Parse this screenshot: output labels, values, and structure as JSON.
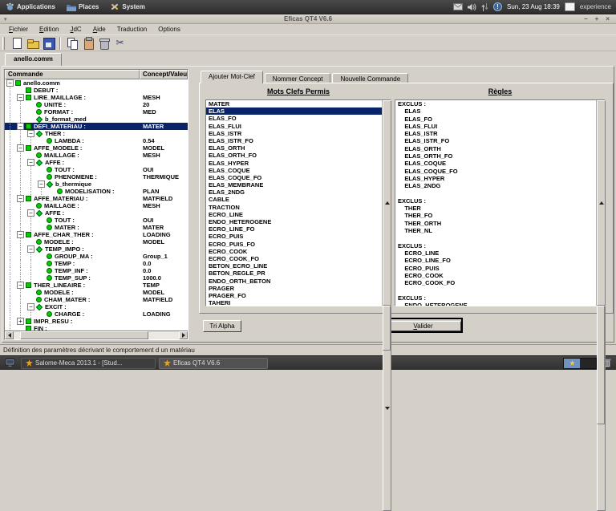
{
  "desktop": {
    "panel": {
      "menus": [
        {
          "label": "Applications",
          "icon": "applications-icon"
        },
        {
          "label": "Places",
          "icon": "places-icon"
        },
        {
          "label": "System",
          "icon": "system-icon"
        }
      ],
      "tray_icons": [
        "mail-icon",
        "volume-icon",
        "network-icon",
        "alert-icon",
        "display-icon"
      ],
      "alert_glyph": "!",
      "clock": "Sun, 23 Aug 18:39",
      "user": "experience"
    },
    "taskbar": {
      "windows": [
        {
          "label": "Salome-Meca 2013.1 - [Stud...",
          "active": false
        },
        {
          "label": "Eficas QT4 V6.6",
          "active": true
        }
      ],
      "workspace_count": 2,
      "active_workspace": 0
    }
  },
  "window": {
    "title": "Eficas QT4 V6.6",
    "controls": {
      "minimize": "–",
      "maximize": "+",
      "close": "×"
    },
    "menu_button_glyph": "▾",
    "menus": [
      {
        "label": "Fichier",
        "accel": 0
      },
      {
        "label": "Edition",
        "accel": 0
      },
      {
        "label": "JdC",
        "accel": 0
      },
      {
        "label": "Aide",
        "accel": 0
      },
      {
        "label": "Traduction",
        "accel": -1
      },
      {
        "label": "Options",
        "accel": -1
      }
    ],
    "toolbar": [
      "new-file",
      "open-file",
      "save",
      "copy",
      "paste",
      "delete",
      "cut"
    ],
    "document_tab": "anello.comm",
    "status_bar": "Définition des paramètres décrivant le comportement d un matériau"
  },
  "tree": {
    "columns": [
      "Commande",
      "Concept/Valeur"
    ],
    "rows": [
      {
        "label": "anello.comm",
        "value": "",
        "icon": "square",
        "level": 0,
        "exp": "minus"
      },
      {
        "label": "DEBUT :",
        "value": "",
        "icon": "square",
        "level": 1,
        "exp": ""
      },
      {
        "label": "LIRE_MAILLAGE :",
        "value": "MESH",
        "icon": "square",
        "level": 1,
        "exp": "minus"
      },
      {
        "label": "UNITE :",
        "value": "20",
        "icon": "circle",
        "level": 2,
        "exp": ""
      },
      {
        "label": "FORMAT :",
        "value": "MED",
        "icon": "circle",
        "level": 2,
        "exp": ""
      },
      {
        "label": "b_format_med",
        "value": "",
        "icon": "diamond",
        "level": 2,
        "exp": ""
      },
      {
        "label": "DEFI_MATERIAU :",
        "value": "MATER",
        "icon": "square",
        "level": 1,
        "exp": "minus",
        "selected": true
      },
      {
        "label": "THER :",
        "value": "",
        "icon": "diamond",
        "level": 2,
        "exp": "minus"
      },
      {
        "label": "LAMBDA :",
        "value": "0.54",
        "icon": "circle",
        "level": 3,
        "exp": ""
      },
      {
        "label": "AFFE_MODELE :",
        "value": "MODEL",
        "icon": "square",
        "level": 1,
        "exp": "minus"
      },
      {
        "label": "MAILLAGE :",
        "value": "MESH",
        "icon": "circle",
        "level": 2,
        "exp": ""
      },
      {
        "label": "AFFE :",
        "value": "",
        "icon": "diamond",
        "level": 2,
        "exp": "minus"
      },
      {
        "label": "TOUT :",
        "value": "OUI",
        "icon": "circle",
        "level": 3,
        "exp": ""
      },
      {
        "label": "PHENOMENE :",
        "value": "THERMIQUE",
        "icon": "circle",
        "level": 3,
        "exp": ""
      },
      {
        "label": "b_thermique",
        "value": "",
        "icon": "diamond",
        "level": 3,
        "exp": "minus"
      },
      {
        "label": "MODELISATION :",
        "value": "PLAN",
        "icon": "circle",
        "level": 4,
        "exp": ""
      },
      {
        "label": "AFFE_MATERIAU :",
        "value": "MATFIELD",
        "icon": "square",
        "level": 1,
        "exp": "minus"
      },
      {
        "label": "MAILLAGE :",
        "value": "MESH",
        "icon": "circle",
        "level": 2,
        "exp": ""
      },
      {
        "label": "AFFE :",
        "value": "",
        "icon": "diamond",
        "level": 2,
        "exp": "minus"
      },
      {
        "label": "TOUT :",
        "value": "OUI",
        "icon": "circle",
        "level": 3,
        "exp": ""
      },
      {
        "label": "MATER :",
        "value": "MATER",
        "icon": "circle",
        "level": 3,
        "exp": ""
      },
      {
        "label": "AFFE_CHAR_THER :",
        "value": "LOADING",
        "icon": "square",
        "level": 1,
        "exp": "minus"
      },
      {
        "label": "MODELE :",
        "value": "MODEL",
        "icon": "circle",
        "level": 2,
        "exp": ""
      },
      {
        "label": "TEMP_IMPO :",
        "value": "",
        "icon": "diamond",
        "level": 2,
        "exp": "minus"
      },
      {
        "label": "GROUP_MA :",
        "value": "Group_1",
        "icon": "circle",
        "level": 3,
        "exp": ""
      },
      {
        "label": "TEMP :",
        "value": "0.0",
        "icon": "circle",
        "level": 3,
        "exp": ""
      },
      {
        "label": "TEMP_INF :",
        "value": "0.0",
        "icon": "circle",
        "level": 3,
        "exp": ""
      },
      {
        "label": "TEMP_SUP :",
        "value": "1000.0",
        "icon": "circle",
        "level": 3,
        "exp": ""
      },
      {
        "label": "THER_LINEAIRE :",
        "value": "TEMP",
        "icon": "square",
        "level": 1,
        "exp": "minus"
      },
      {
        "label": "MODELE :",
        "value": "MODEL",
        "icon": "circle",
        "level": 2,
        "exp": ""
      },
      {
        "label": "CHAM_MATER :",
        "value": "MATFIELD",
        "icon": "circle",
        "level": 2,
        "exp": ""
      },
      {
        "label": "EXCIT :",
        "value": "",
        "icon": "diamond",
        "level": 2,
        "exp": "minus"
      },
      {
        "label": "CHARGE :",
        "value": "LOADING",
        "icon": "circle",
        "level": 3,
        "exp": ""
      },
      {
        "label": "IMPR_RESU :",
        "value": "",
        "icon": "square",
        "level": 1,
        "exp": "plus"
      },
      {
        "label": "FIN :",
        "value": "",
        "icon": "square",
        "level": 1,
        "exp": ""
      }
    ]
  },
  "right_panel": {
    "tabs": [
      "Ajouter Mot-Clef",
      "Nommer Concept",
      "Nouvelle Commande"
    ],
    "active_tab": "Ajouter Mot-Clef",
    "keywords": {
      "title": "Mots Clefs Permis",
      "selected": "ELAS",
      "items": [
        "MATER",
        "ELAS",
        "ELAS_FO",
        "ELAS_FLUI",
        "ELAS_ISTR",
        "ELAS_ISTR_FO",
        "ELAS_ORTH",
        "ELAS_ORTH_FO",
        "ELAS_HYPER",
        "ELAS_COQUE",
        "ELAS_COQUE_FO",
        "ELAS_MEMBRANE",
        "ELAS_2NDG",
        "CABLE",
        "TRACTION",
        "ECRO_LINE",
        "ENDO_HETEROGENE",
        "ECRO_LINE_FO",
        "ECRO_PUIS",
        "ECRO_PUIS_FO",
        "ECRO_COOK",
        "ECRO_COOK_FO",
        "BETON_ECRO_LINE",
        "BETON_REGLE_PR",
        "ENDO_ORTH_BETON",
        "PRAGER",
        "PRAGER_FO",
        "TAHERI"
      ]
    },
    "rules": {
      "title": "Règles",
      "lines": [
        "EXCLUS :",
        "    ELAS",
        "    ELAS_FO",
        "    ELAS_FLUI",
        "    ELAS_ISTR",
        "    ELAS_ISTR_FO",
        "    ELAS_ORTH",
        "    ELAS_ORTH_FO",
        "    ELAS_COQUE",
        "    ELAS_COQUE_FO",
        "    ELAS_HYPER",
        "    ELAS_2NDG",
        "",
        "EXCLUS :",
        "    THER",
        "    THER_FO",
        "    THER_ORTH",
        "    THER_NL",
        "",
        "EXCLUS :",
        "    ECRO_LINE",
        "    ECRO_LINE_FO",
        "    ECRO_PUIS",
        "    ECRO_COOK",
        "    ECRO_COOK_FO",
        "",
        "EXCLUS :",
        "    ENDO_HETEROGENE"
      ]
    },
    "buttons": {
      "tri_alpha": "Tri Alpha",
      "valider": "Valider",
      "valider_accel": 0
    }
  },
  "colors": {
    "selection": "#0a246a",
    "node_green": "#00cc00",
    "window_bg": "#d4d0c8",
    "panel_dark": "#2e2e2e"
  }
}
